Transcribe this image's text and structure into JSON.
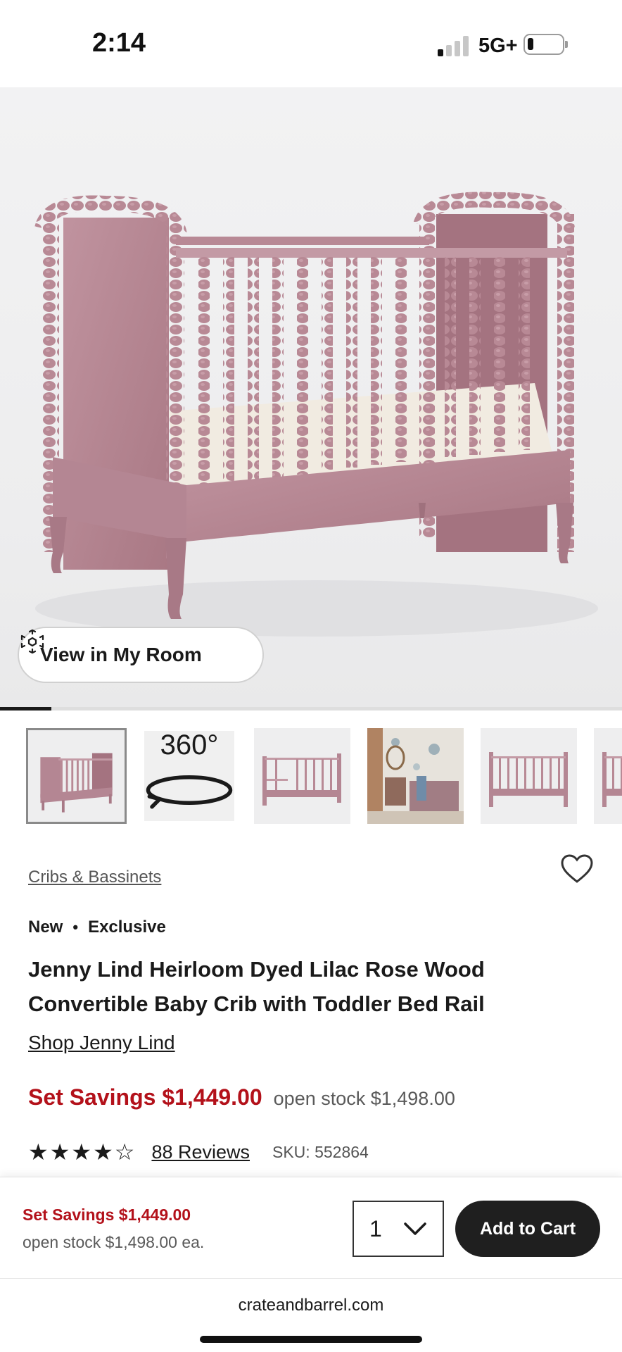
{
  "status_bar": {
    "time": "2:14",
    "network": "5G+",
    "signal_bars_active": 1,
    "battery_level": 0.12
  },
  "hero": {
    "view_in_room_label": "View in My Room",
    "ar_icon": "ar-cube-icon",
    "gallery_progress": 0.083
  },
  "thumbnails": [
    {
      "kind": "crib-front",
      "selected": true
    },
    {
      "kind": "360",
      "label": "360°"
    },
    {
      "kind": "toddler-rail"
    },
    {
      "kind": "nursery-room"
    },
    {
      "kind": "crib-side"
    },
    {
      "kind": "crib-partial"
    }
  ],
  "product": {
    "category": "Cribs & Bassinets",
    "wishlist_icon": "heart-icon",
    "tags": [
      "New",
      "Exclusive"
    ],
    "tag_separator": "•",
    "title_lines": [
      "Jenny Lind Heirloom Dyed Lilac Rose Wood",
      "Convertible Baby Crib with Toddler Bed Rail"
    ],
    "shop_link": "Shop Jenny Lind",
    "sale_price": "Set Savings $1,449.00",
    "open_stock_price": "open stock $1,498.00",
    "rating": 4,
    "rating_max": 5,
    "reviews_label": "88 Reviews",
    "sku": "SKU: 552864"
  },
  "sticky_bar": {
    "sale_price": "Set Savings $1,449.00",
    "open_stock_price": "open stock $1,498.00 ea.",
    "quantity": "1",
    "add_to_cart_label": "Add to Cart"
  },
  "browser": {
    "url": "crateandbarrel.com"
  },
  "colors": {
    "accent_red": "#b3111a",
    "button_dark": "#1f1f1f",
    "crib_rose": "#b58794"
  }
}
